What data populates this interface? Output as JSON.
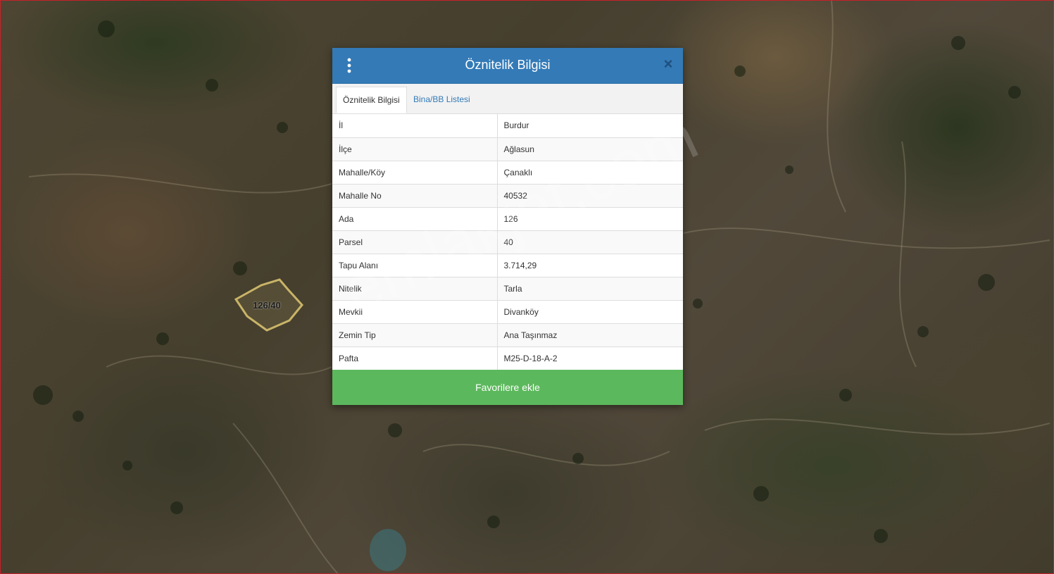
{
  "dialog": {
    "title": "Öznitelik Bilgisi",
    "menu_icon": "vertical-dots-icon",
    "close_icon": "close-icon",
    "close_symbol": "×",
    "tabs": [
      {
        "label": "Öznitelik Bilgisi",
        "active": true
      },
      {
        "label": "Bina/BB Listesi",
        "active": false
      }
    ],
    "rows": [
      {
        "key": "İl",
        "value": "Burdur"
      },
      {
        "key": "İlçe",
        "value": "Ağlasun"
      },
      {
        "key": "Mahalle/Köy",
        "value": "Çanaklı"
      },
      {
        "key": "Mahalle No",
        "value": "40532"
      },
      {
        "key": "Ada",
        "value": "126"
      },
      {
        "key": "Parsel",
        "value": "40"
      },
      {
        "key": "Tapu Alanı",
        "value": "3.714,29"
      },
      {
        "key": "Nitelik",
        "value": "Tarla"
      },
      {
        "key": "Mevkii",
        "value": "Divanköy"
      },
      {
        "key": "Zemin Tip",
        "value": "Ana Taşınmaz"
      },
      {
        "key": "Pafta",
        "value": "M25-D-18-A-2"
      }
    ],
    "favorite_button": "Favorilere ekle"
  },
  "map": {
    "parcel_label": "126/40",
    "parcel_outline_color": "#c9b468",
    "watermark": "emlakjet.com"
  },
  "colors": {
    "header": "#337ab7",
    "button": "#5cb85c",
    "link": "#337ab7"
  }
}
